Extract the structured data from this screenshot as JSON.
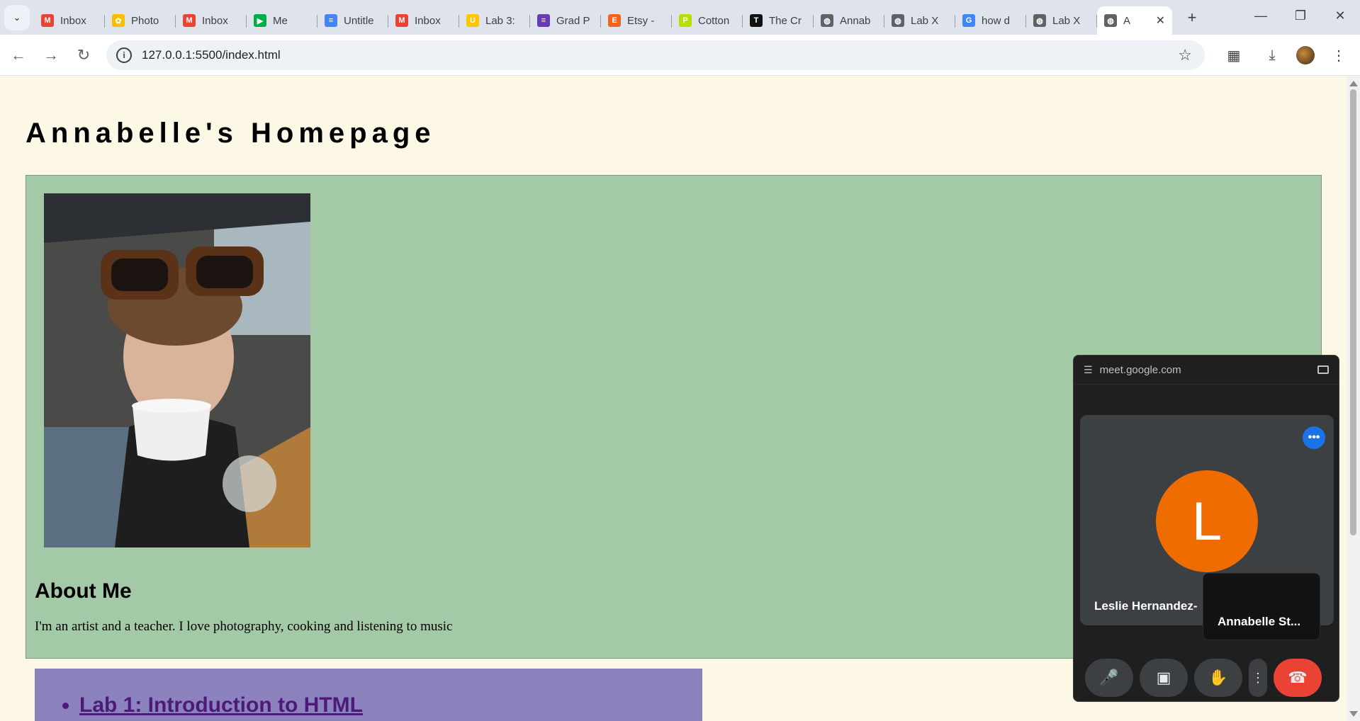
{
  "browser": {
    "tabs": [
      {
        "title": "Inbox",
        "icon": "gmail-icon",
        "color": "#ea4335"
      },
      {
        "title": "Photo",
        "icon": "photos-icon",
        "color": "#fbbc04"
      },
      {
        "title": "Inbox",
        "icon": "gmail-icon",
        "color": "#ea4335"
      },
      {
        "title": "Me",
        "icon": "meet-icon",
        "color": "#00ac47"
      },
      {
        "title": "Untitle",
        "icon": "docs-icon",
        "color": "#4285f4"
      },
      {
        "title": "Inbox",
        "icon": "gmail-icon",
        "color": "#ea4335"
      },
      {
        "title": "Lab 3:",
        "icon": "ucsc-icon",
        "color": "#fdc700"
      },
      {
        "title": "Grad P",
        "icon": "forms-icon",
        "color": "#673ab7"
      },
      {
        "title": "Etsy -",
        "icon": "etsy-icon",
        "color": "#f1641e"
      },
      {
        "title": "Cotton",
        "icon": "cotton-icon",
        "color": "#b6e000"
      },
      {
        "title": "The Cr",
        "icon": "nyt-icon",
        "color": "#111111"
      },
      {
        "title": "Annab",
        "icon": "globe-icon",
        "color": "#5f6368"
      },
      {
        "title": "Lab X",
        "icon": "globe-icon",
        "color": "#5f6368"
      },
      {
        "title": "how d",
        "icon": "google-icon",
        "color": "#4285f4"
      },
      {
        "title": "Lab X",
        "icon": "globe-icon",
        "color": "#5f6368"
      },
      {
        "title": "A",
        "icon": "globe-icon",
        "color": "#5f6368",
        "active": true
      }
    ],
    "url": "127.0.0.1:5500/index.html"
  },
  "page": {
    "title": "Annabelle's Homepage",
    "about_heading": "About Me",
    "about_text": "I'm an artist and a teacher. I love photography, cooking and listening to music",
    "links": [
      "Lab 1: Introduction to HTML"
    ],
    "colors": {
      "background": "#fdf8e6",
      "green_box": "#a3c9a6",
      "purple_box": "#8c82be",
      "link": "#4b1a7a"
    }
  },
  "meet_pip": {
    "origin": "meet.google.com",
    "participant_initial": "L",
    "participant_name": "Leslie Hernandez-",
    "self_name": "Annabelle St...",
    "avatar_color": "#ef6c00"
  }
}
